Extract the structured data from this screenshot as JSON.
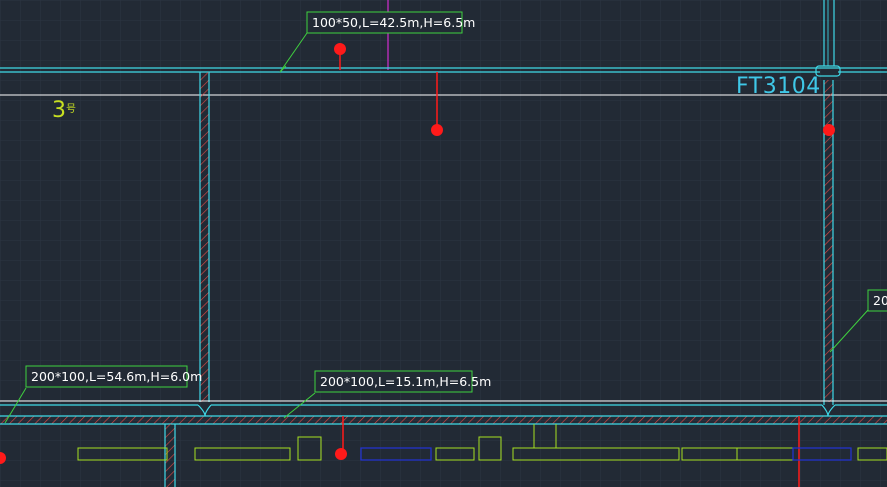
{
  "drawing": {
    "background": "#222a35",
    "colors": {
      "grid": "#2c3542",
      "wall": "#3fd9e8",
      "hatch": "#d84a46",
      "beam": "#ffffff",
      "label_border": "#3fd13f",
      "marker": "#ff1a1a",
      "equipment": "#a6e021",
      "equipment_blue": "#2233d6",
      "axis_mark": "#d12fd1",
      "room_tag": "#3fc8e8",
      "floor_tag": "#c8e021"
    },
    "room_tag": "FT3104",
    "floor_tag": "3",
    "floor_tag_suffix": "号",
    "labels": {
      "top_duct": "100*50,L=42.5m,H=6.5m",
      "left_duct": "200*100,L=54.6m,H=6.0m",
      "middle_duct": "200*100,L=15.1m,H=6.5m",
      "right_duct_partial": "20"
    }
  }
}
